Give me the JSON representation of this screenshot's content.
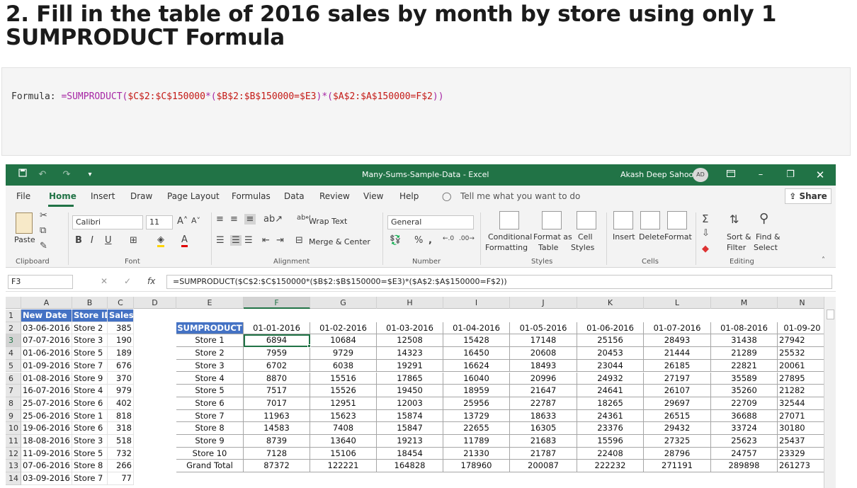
{
  "heading": "2. Fill in the table of 2016 sales by month by store using only 1 SUMPRODUCT Formula",
  "code": {
    "label": "Formula: ",
    "fn": "=SUMPRODUCT(",
    "p1": "$C$2:$C$150000",
    "op1": "*(",
    "p2": "$B$2:$B$150000=$E3",
    "op2": ")*(",
    "p3": "$A$2:$A$150000=F$2",
    "op3": "))"
  },
  "window": {
    "title": "Many-Sums-Sample-Data  -  Excel",
    "user": "Akash Deep Sahoo",
    "avatar": "AD"
  },
  "menu": {
    "items": [
      "File",
      "Home",
      "Insert",
      "Draw",
      "Page Layout",
      "Formulas",
      "Data",
      "Review",
      "View",
      "Help"
    ],
    "tell_me": "Tell me what you want to do",
    "share": "Share"
  },
  "ribbon": {
    "paste": "Paste",
    "font_name": "Calibri",
    "font_size": "11",
    "wrap_text": "Wrap Text",
    "merge_center": "Merge & Center",
    "number_format": "General",
    "conditional": "Conditional",
    "formatting": "Formatting",
    "format_as": "Format as",
    "table": "Table",
    "cell": "Cell",
    "styles_btn": "Styles",
    "insert": "Insert",
    "delete": "Delete",
    "format": "Format",
    "sort": "Sort &",
    "filter": "Filter",
    "find": "Find &",
    "select": "Select",
    "groups": {
      "clipboard": "Clipboard",
      "font": "Font",
      "alignment": "Alignment",
      "number": "Number",
      "styles": "Styles",
      "cells": "Cells",
      "editing": "Editing"
    }
  },
  "formula_bar": {
    "name_box": "F3",
    "formula": "=SUMPRODUCT($C$2:$C$150000*($B$2:$B$150000=$E3)*($A$2:$A$150000=F$2))"
  },
  "columns": [
    "A",
    "B",
    "C",
    "D",
    "E",
    "F",
    "G",
    "H",
    "I",
    "J",
    "K",
    "L",
    "M",
    "N"
  ],
  "rows": [
    "1",
    "2",
    "3",
    "4",
    "5",
    "6",
    "7",
    "8",
    "9",
    "10",
    "11",
    "12",
    "13",
    "14"
  ],
  "source_table": {
    "headers": [
      "New Date",
      "Store ID",
      "Sales"
    ],
    "rows": [
      [
        "03-06-2016",
        "Store 2",
        "385"
      ],
      [
        "07-07-2016",
        "Store 3",
        "190"
      ],
      [
        "01-06-2016",
        "Store 5",
        "189"
      ],
      [
        "01-09-2016",
        "Store 7",
        "676"
      ],
      [
        "01-08-2016",
        "Store 9",
        "370"
      ],
      [
        "16-07-2016",
        "Store 4",
        "979"
      ],
      [
        "25-07-2016",
        "Store 6",
        "402"
      ],
      [
        "25-06-2016",
        "Store 1",
        "818"
      ],
      [
        "19-06-2016",
        "Store 6",
        "318"
      ],
      [
        "18-08-2016",
        "Store 3",
        "518"
      ],
      [
        "11-09-2016",
        "Store 5",
        "732"
      ],
      [
        "07-06-2016",
        "Store 8",
        "266"
      ],
      [
        "03-09-2016",
        "Store 7",
        "77"
      ]
    ]
  },
  "pivot": {
    "corner": "SUMPRODUCT",
    "months": [
      "01-01-2016",
      "01-02-2016",
      "01-03-2016",
      "01-04-2016",
      "01-05-2016",
      "01-06-2016",
      "01-07-2016",
      "01-08-2016",
      "01-09-20"
    ],
    "rows": [
      {
        "label": "Store 1",
        "values": [
          "6894",
          "10684",
          "12508",
          "15428",
          "17148",
          "25156",
          "28493",
          "31438",
          "27942"
        ]
      },
      {
        "label": "Store 2",
        "values": [
          "7959",
          "9729",
          "14323",
          "16450",
          "20608",
          "20453",
          "21444",
          "21289",
          "25532"
        ]
      },
      {
        "label": "Store 3",
        "values": [
          "6702",
          "6038",
          "19291",
          "16624",
          "18493",
          "23044",
          "26185",
          "22821",
          "20061"
        ]
      },
      {
        "label": "Store 4",
        "values": [
          "8870",
          "15516",
          "17865",
          "16040",
          "20996",
          "24932",
          "27197",
          "35589",
          "27895"
        ]
      },
      {
        "label": "Store 5",
        "values": [
          "7517",
          "15526",
          "19450",
          "18959",
          "21647",
          "24641",
          "26107",
          "35260",
          "21282"
        ]
      },
      {
        "label": "Store 6",
        "values": [
          "7017",
          "12951",
          "12003",
          "25956",
          "22787",
          "18265",
          "29697",
          "22709",
          "32544"
        ]
      },
      {
        "label": "Store 7",
        "values": [
          "11963",
          "15623",
          "15874",
          "13729",
          "18633",
          "24361",
          "26515",
          "36688",
          "27071"
        ]
      },
      {
        "label": "Store 8",
        "values": [
          "14583",
          "7408",
          "15847",
          "22655",
          "16305",
          "23376",
          "29432",
          "33724",
          "30180"
        ]
      },
      {
        "label": "Store 9",
        "values": [
          "8739",
          "13640",
          "19213",
          "11789",
          "21683",
          "15596",
          "27325",
          "25623",
          "25437"
        ]
      },
      {
        "label": "Store 10",
        "values": [
          "7128",
          "15106",
          "18454",
          "21330",
          "21787",
          "22408",
          "28796",
          "24757",
          "23329"
        ]
      },
      {
        "label": "Grand Total",
        "values": [
          "87372",
          "122221",
          "164828",
          "178960",
          "200087",
          "222232",
          "271191",
          "289898",
          "261273"
        ]
      }
    ]
  }
}
